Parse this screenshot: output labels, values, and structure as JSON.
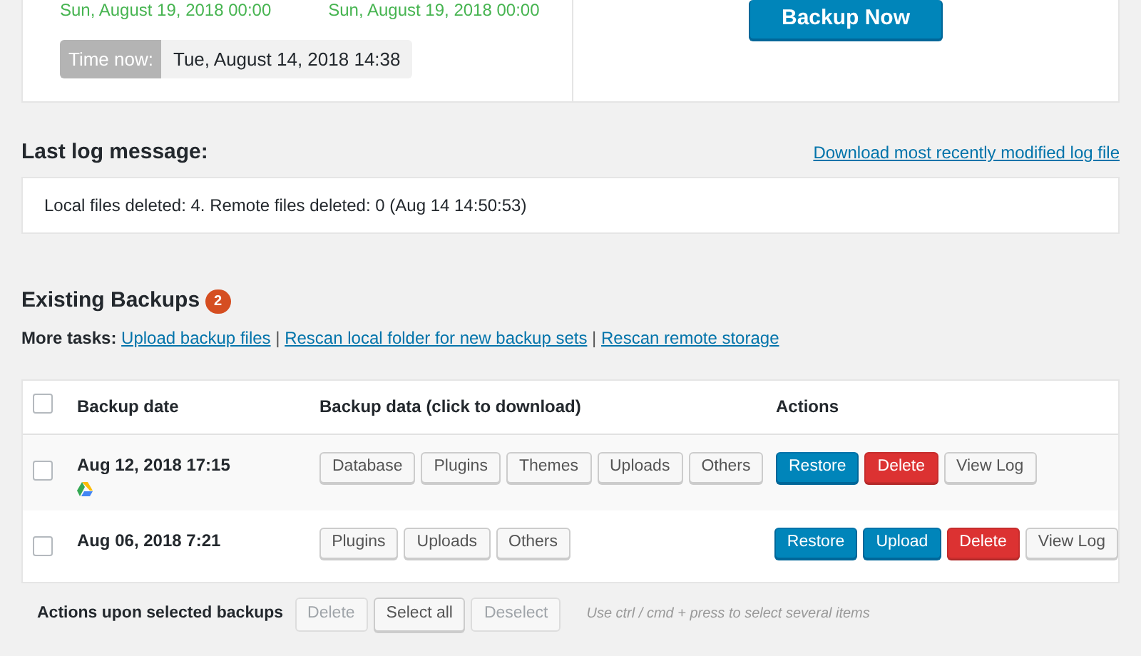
{
  "schedule": {
    "next_runs": [
      "Sun, August 19, 2018 00:00",
      "Sun, August 19, 2018 00:00"
    ],
    "time_now_label": "Time now:",
    "time_now": "Tue, August 14, 2018 14:38",
    "backup_button": "Backup Now"
  },
  "log": {
    "title": "Last log message:",
    "download_link": "Download most recently modified log file",
    "message": "Local files deleted: 4. Remote files deleted: 0 (Aug 14 14:50:53)"
  },
  "existing": {
    "title": "Existing Backups",
    "count": "2",
    "more_tasks_label": "More tasks:",
    "separators": [
      "|",
      "|"
    ],
    "links": [
      "Upload backup files",
      "Rescan local folder for new backup sets",
      "Rescan remote storage"
    ]
  },
  "table": {
    "select_all_checked": false,
    "columns": [
      "Backup date",
      "Backup data (click to download)",
      "Actions"
    ],
    "rows": [
      {
        "checked": false,
        "date": "Aug 12, 2018 17:15",
        "remote_storage": true,
        "data": [
          "Database",
          "Plugins",
          "Themes",
          "Uploads",
          "Others"
        ],
        "actions": [
          {
            "label": "Restore",
            "kind": "primary"
          },
          {
            "label": "Delete",
            "kind": "danger"
          },
          {
            "label": "View Log",
            "kind": "default"
          }
        ]
      },
      {
        "checked": false,
        "date": "Aug 06, 2018 7:21",
        "remote_storage": false,
        "data": [
          "Plugins",
          "Uploads",
          "Others"
        ],
        "actions": [
          {
            "label": "Restore",
            "kind": "primary"
          },
          {
            "label": "Upload",
            "kind": "primary"
          },
          {
            "label": "Delete",
            "kind": "danger"
          },
          {
            "label": "View Log",
            "kind": "default"
          }
        ]
      }
    ]
  },
  "bulk": {
    "label": "Actions upon selected backups",
    "buttons": [
      {
        "label": "Delete",
        "disabled": true
      },
      {
        "label": "Select all",
        "disabled": false
      },
      {
        "label": "Deselect",
        "disabled": true
      }
    ],
    "hint": "Use ctrl / cmd + press to select several items"
  }
}
